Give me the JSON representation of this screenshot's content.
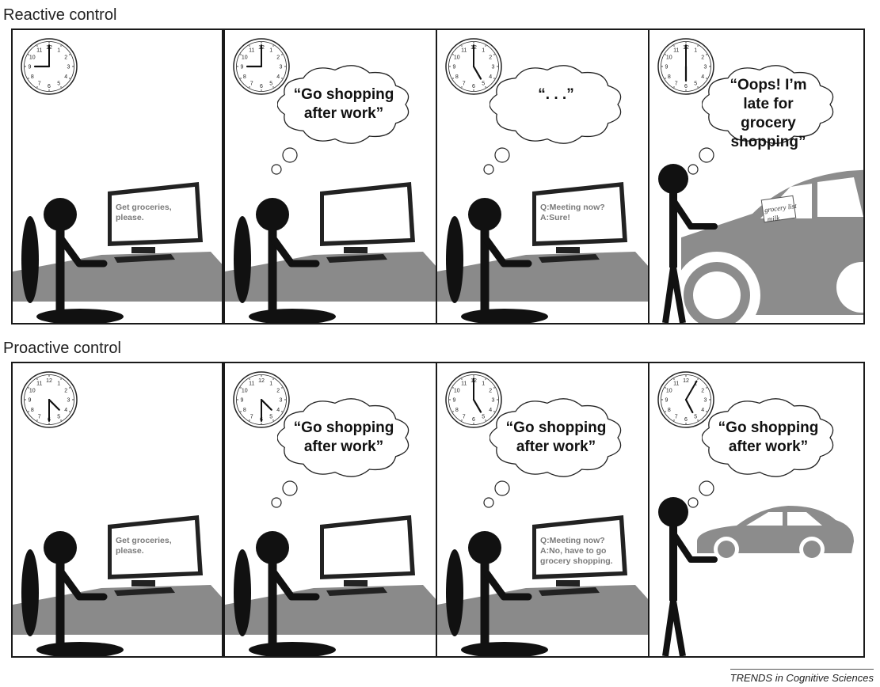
{
  "rows": [
    {
      "title": "Reactive control",
      "panels": [
        {
          "clock": {
            "hour": 9,
            "minute": 0
          },
          "thought": "",
          "screen": "Get groceries, please.",
          "ending": "desk"
        },
        {
          "clock": {
            "hour": 9,
            "minute": 0
          },
          "thought": "“Go shopping after work”",
          "screen": "",
          "ending": "desk"
        },
        {
          "clock": {
            "hour": 5,
            "minute": 0
          },
          "thought": "“. . .”",
          "screen": "Q:Meeting now? A:Sure!",
          "ending": "desk"
        },
        {
          "clock": {
            "hour": 6,
            "minute": 0
          },
          "thought": "“Oops! I’m late for grocery shopping”",
          "screen": "",
          "ending": "car-near",
          "note": "grocery list milk"
        }
      ]
    },
    {
      "title": "Proactive control",
      "panels": [
        {
          "clock": {
            "hour": 4,
            "minute": 30
          },
          "thought": "",
          "screen": "Get groceries, please.",
          "ending": "desk"
        },
        {
          "clock": {
            "hour": 4,
            "minute": 30
          },
          "thought": "“Go shopping after work”",
          "screen": "",
          "ending": "desk"
        },
        {
          "clock": {
            "hour": 5,
            "minute": 0
          },
          "thought": "“Go shopping after work”",
          "screen": "Q:Meeting now? A:No, have to go grocery shopping.",
          "ending": "desk"
        },
        {
          "clock": {
            "hour": 5,
            "minute": 5
          },
          "thought": "“Go shopping after work”",
          "screen": "",
          "ending": "car-far"
        }
      ]
    }
  ],
  "footer": "TRENDS in Cognitive Sciences",
  "colors": {
    "desk": "#8a8a8a",
    "figure": "#111111",
    "car": "#8c8c8c",
    "border": "#1a1a1a"
  }
}
